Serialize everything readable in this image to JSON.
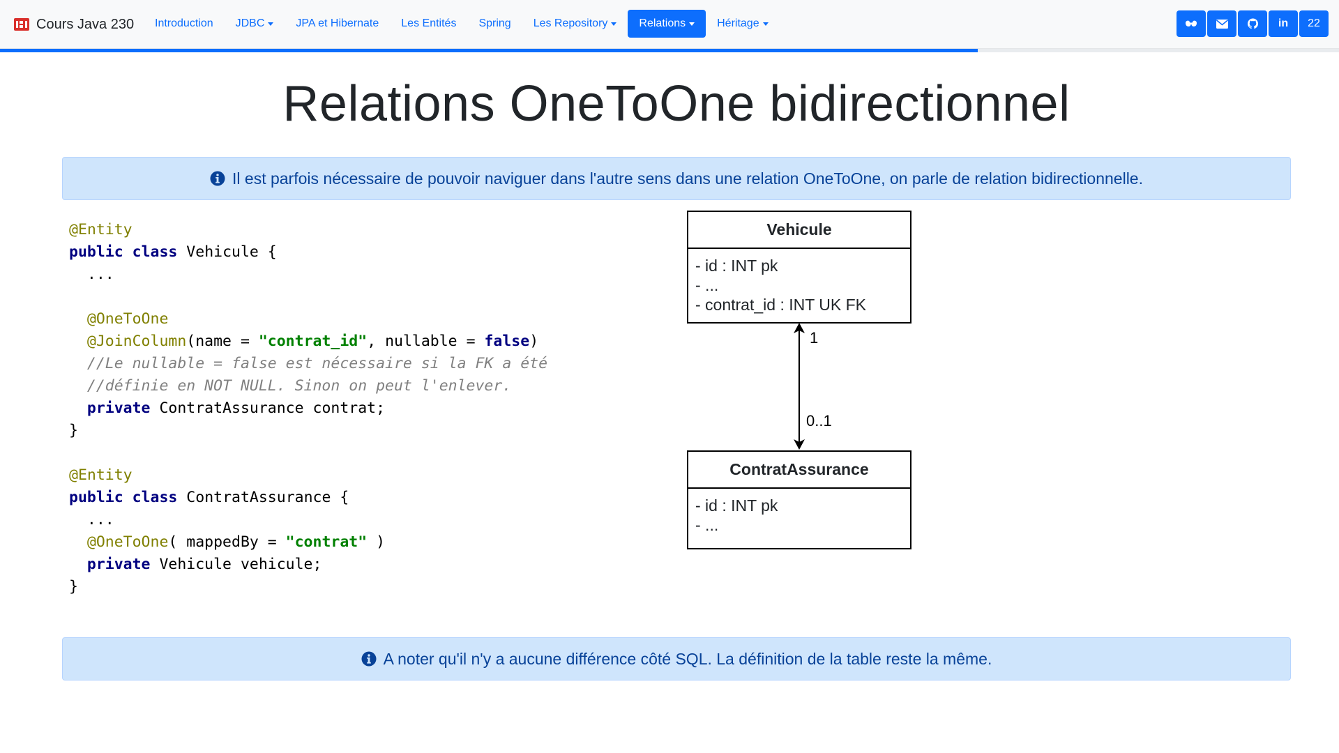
{
  "navbar": {
    "brand": "Cours Java 230",
    "items": [
      {
        "label": "Introduction",
        "dropdown": false,
        "active": false
      },
      {
        "label": "JDBC",
        "dropdown": true,
        "active": false
      },
      {
        "label": "JPA et Hibernate",
        "dropdown": false,
        "active": false
      },
      {
        "label": "Les Entités",
        "dropdown": false,
        "active": false
      },
      {
        "label": "Spring",
        "dropdown": false,
        "active": false
      },
      {
        "label": "Les Repository",
        "dropdown": true,
        "active": false
      },
      {
        "label": "Relations",
        "dropdown": true,
        "active": true
      },
      {
        "label": "Héritage",
        "dropdown": true,
        "active": false
      }
    ],
    "social": [
      {
        "icon": "glasses-icon"
      },
      {
        "icon": "envelope-icon"
      },
      {
        "icon": "github-icon"
      },
      {
        "icon": "linkedin-icon",
        "label": "in"
      },
      {
        "icon": "page-number",
        "label": "22"
      }
    ],
    "progress": 0.73
  },
  "page": {
    "title": "Relations OneToOne bidirectionnel",
    "alert_top": "Il est parfois nécessaire de pouvoir naviguer dans l'autre sens dans une relation OneToOne, on parle de relation bidirectionnelle.",
    "alert_bottom": "A noter qu'il n'y a aucune différence côté SQL. La définition de la table reste la même."
  },
  "code": {
    "lines": [
      [
        {
          "t": "ann",
          "v": "@Entity"
        }
      ],
      [
        {
          "t": "kw",
          "v": "public"
        },
        {
          "t": "",
          "v": " "
        },
        {
          "t": "kw",
          "v": "class"
        },
        {
          "t": "",
          "v": " Vehicule {"
        }
      ],
      [
        {
          "t": "",
          "v": "  ..."
        }
      ],
      [
        {
          "t": "",
          "v": ""
        }
      ],
      [
        {
          "t": "",
          "v": "  "
        },
        {
          "t": "ann",
          "v": "@OneToOne"
        }
      ],
      [
        {
          "t": "",
          "v": "  "
        },
        {
          "t": "ann",
          "v": "@JoinColumn"
        },
        {
          "t": "",
          "v": "(name = "
        },
        {
          "t": "str",
          "v": "\"contrat_id\""
        },
        {
          "t": "",
          "v": ", nullable = "
        },
        {
          "t": "kw",
          "v": "false"
        },
        {
          "t": "",
          "v": ")"
        }
      ],
      [
        {
          "t": "",
          "v": "  "
        },
        {
          "t": "cmt",
          "v": "//Le nullable = false est nécessaire si la FK a été"
        }
      ],
      [
        {
          "t": "",
          "v": "  "
        },
        {
          "t": "cmt",
          "v": "//définie en NOT NULL. Sinon on peut l'enlever."
        }
      ],
      [
        {
          "t": "",
          "v": "  "
        },
        {
          "t": "kw",
          "v": "private"
        },
        {
          "t": "",
          "v": " ContratAssurance contrat;"
        }
      ],
      [
        {
          "t": "",
          "v": "}"
        }
      ],
      [
        {
          "t": "",
          "v": ""
        }
      ],
      [
        {
          "t": "ann",
          "v": "@Entity"
        }
      ],
      [
        {
          "t": "kw",
          "v": "public"
        },
        {
          "t": "",
          "v": " "
        },
        {
          "t": "kw",
          "v": "class"
        },
        {
          "t": "",
          "v": " ContratAssurance {"
        }
      ],
      [
        {
          "t": "",
          "v": "  ..."
        }
      ],
      [
        {
          "t": "",
          "v": "  "
        },
        {
          "t": "ann",
          "v": "@OneToOne"
        },
        {
          "t": "",
          "v": "( mappedBy = "
        },
        {
          "t": "str",
          "v": "\"contrat\""
        },
        {
          "t": "",
          "v": " )"
        }
      ],
      [
        {
          "t": "",
          "v": "  "
        },
        {
          "t": "kw",
          "v": "private"
        },
        {
          "t": "",
          "v": " Vehicule vehicule;"
        }
      ],
      [
        {
          "t": "",
          "v": "}"
        }
      ]
    ]
  },
  "diagram": {
    "vehicule": {
      "name": "Vehicule",
      "attrs": [
        "- id : INT pk",
        "- ...",
        "- contrat_id : INT UK FK"
      ]
    },
    "contrat": {
      "name": "ContratAssurance",
      "attrs": [
        "- id : INT pk",
        "- ..."
      ]
    },
    "multiplicity_top": "1",
    "multiplicity_bottom": "0..1"
  },
  "colors": {
    "primary": "#0d6efd",
    "alert_bg": "#cfe5fc",
    "alert_text": "#084298"
  }
}
